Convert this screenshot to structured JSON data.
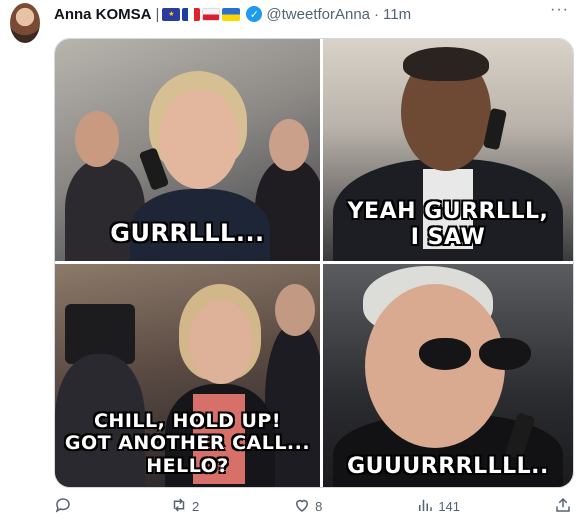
{
  "tweet": {
    "author_name": "Anna KOMSA",
    "separator": "|",
    "flags": [
      "eu-flag",
      "fr-flag",
      "pl-flag",
      "ua-flag"
    ],
    "handle": "@tweetforAnna",
    "dot": "·",
    "time": "11m"
  },
  "media": {
    "captions": {
      "panel1": "GURRLLL...",
      "panel2_line1": "YEAH GURRLLL,",
      "panel2_line2": "I SAW",
      "panel3_line1": "CHILL, HOLD UP!",
      "panel3_line2": "GOT ANOTHER CALL...",
      "panel3_line3": "HELLO?",
      "panel4": "GUUURRRLLLL.."
    }
  },
  "actions": {
    "reply_count": "",
    "retweet_count": "2",
    "like_count": "8",
    "view_count": "141"
  },
  "colors": {
    "text_primary": "#0f1419",
    "text_secondary": "#536471",
    "verified_blue": "#1d9bf0",
    "border": "#cfd9de"
  }
}
